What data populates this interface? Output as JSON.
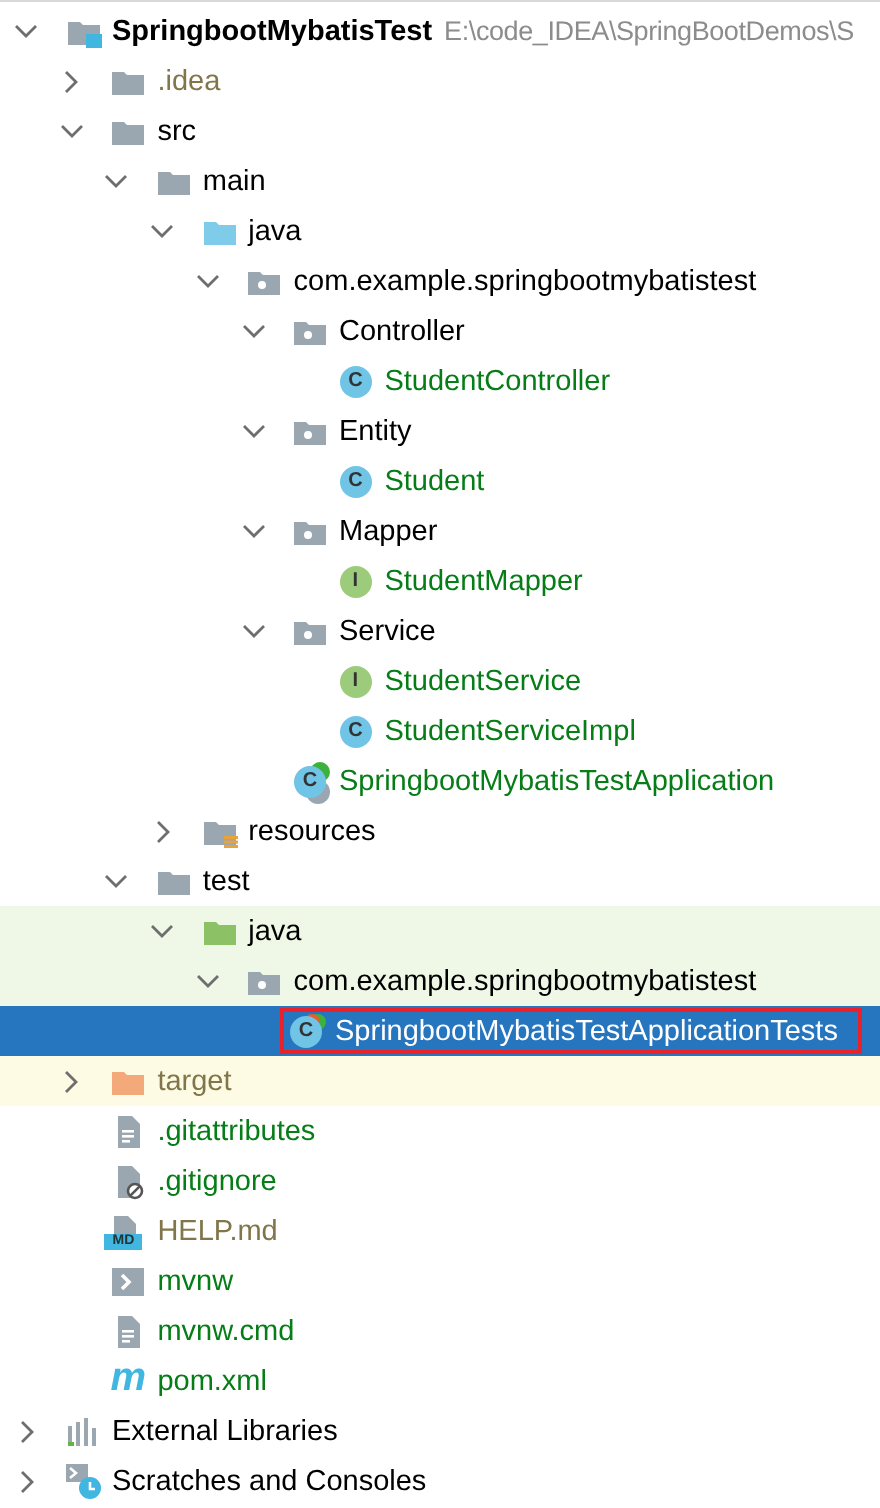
{
  "tree": [
    {
      "name": "SpringbootMybatisTest",
      "path": "E:\\code_IDEA\\SpringBootDemos\\S",
      "kind": "project",
      "color": "#000000",
      "expanded": true,
      "selected": false,
      "outlined": false,
      "children": [
        {
          "name": ".idea",
          "kind": "folder",
          "color": "#80764a",
          "expanded": false,
          "selected": false,
          "outlined": false
        },
        {
          "name": "src",
          "kind": "folder",
          "color": "#000000",
          "expanded": true,
          "selected": false,
          "outlined": false,
          "children": [
            {
              "name": "main",
              "kind": "folder",
              "color": "#000000",
              "expanded": true,
              "selected": false,
              "outlined": false,
              "children": [
                {
                  "name": "java",
                  "kind": "source-folder",
                  "color": "#000000",
                  "expanded": true,
                  "selected": false,
                  "outlined": false,
                  "children": [
                    {
                      "name": "com.example.springbootmybatistest",
                      "kind": "package",
                      "color": "#000000",
                      "expanded": true,
                      "selected": false,
                      "outlined": false,
                      "children": [
                        {
                          "name": "Controller",
                          "kind": "package",
                          "color": "#000000",
                          "expanded": true,
                          "selected": false,
                          "outlined": false,
                          "children": [
                            {
                              "name": "StudentController",
                              "kind": "class",
                              "icon_text": "C",
                              "color": "#067d17",
                              "selected": false,
                              "outlined": false
                            }
                          ]
                        },
                        {
                          "name": "Entity",
                          "kind": "package",
                          "color": "#000000",
                          "expanded": true,
                          "selected": false,
                          "outlined": false,
                          "children": [
                            {
                              "name": "Student",
                              "kind": "class",
                              "icon_text": "C",
                              "color": "#067d17",
                              "selected": false,
                              "outlined": false
                            }
                          ]
                        },
                        {
                          "name": "Mapper",
                          "kind": "package",
                          "color": "#000000",
                          "expanded": true,
                          "selected": false,
                          "outlined": false,
                          "children": [
                            {
                              "name": "StudentMapper",
                              "kind": "interface",
                              "icon_text": "I",
                              "color": "#067d17",
                              "selected": false,
                              "outlined": false
                            }
                          ]
                        },
                        {
                          "name": "Service",
                          "kind": "package",
                          "color": "#000000",
                          "expanded": true,
                          "selected": false,
                          "outlined": false,
                          "children": [
                            {
                              "name": "StudentService",
                              "kind": "interface",
                              "icon_text": "I",
                              "color": "#067d17",
                              "selected": false,
                              "outlined": false
                            },
                            {
                              "name": "StudentServiceImpl",
                              "kind": "class",
                              "icon_text": "C",
                              "color": "#067d17",
                              "selected": false,
                              "outlined": false
                            }
                          ]
                        },
                        {
                          "name": "SpringbootMybatisTestApplication",
                          "kind": "spring-app",
                          "icon_text": "C",
                          "color": "#067d17",
                          "selected": false,
                          "outlined": false
                        }
                      ]
                    }
                  ]
                },
                {
                  "name": "resources",
                  "kind": "resources-folder",
                  "color": "#000000",
                  "expanded": false,
                  "selected": false,
                  "outlined": false
                }
              ]
            },
            {
              "name": "test",
              "kind": "folder",
              "color": "#000000",
              "expanded": true,
              "selected": false,
              "outlined": false,
              "children": [
                {
                  "name": "java",
                  "kind": "test-folder",
                  "test_source": true,
                  "color": "#000000",
                  "expanded": true,
                  "selected": false,
                  "outlined": false,
                  "children": [
                    {
                      "name": "com.example.springbootmybatistest",
                      "kind": "package",
                      "test_source": true,
                      "color": "#000000",
                      "expanded": true,
                      "selected": false,
                      "outlined": false,
                      "children": [
                        {
                          "name": "SpringbootMybatisTestApplicationTests",
                          "kind": "test-class",
                          "icon_text": "C",
                          "selected": true,
                          "outlined": true
                        }
                      ]
                    }
                  ]
                }
              ]
            }
          ]
        },
        {
          "name": "target",
          "kind": "excluded-folder",
          "excluded": true,
          "color": "#80764a",
          "expanded": false,
          "selected": false,
          "outlined": false
        },
        {
          "name": ".gitattributes",
          "kind": "text-file",
          "color": "#067d17",
          "selected": false,
          "outlined": false
        },
        {
          "name": ".gitignore",
          "kind": "ignore-file",
          "color": "#067d17",
          "selected": false,
          "outlined": false
        },
        {
          "name": "HELP.md",
          "kind": "markdown-file",
          "icon_text": "MD",
          "color": "#80764a",
          "selected": false,
          "outlined": false
        },
        {
          "name": "mvnw",
          "kind": "script-file",
          "color": "#067d17",
          "selected": false,
          "outlined": false
        },
        {
          "name": "mvnw.cmd",
          "kind": "text-file",
          "color": "#067d17",
          "selected": false,
          "outlined": false
        },
        {
          "name": "pom.xml",
          "kind": "maven-file",
          "icon_text": "m",
          "color": "#067d17",
          "selected": false,
          "outlined": false
        }
      ]
    },
    {
      "name": "External Libraries",
      "kind": "libraries",
      "color": "#000000",
      "expanded": false,
      "selected": false,
      "outlined": false
    },
    {
      "name": "Scratches and Consoles",
      "kind": "scratches",
      "color": "#000000",
      "expanded": false,
      "selected": false,
      "outlined": false
    }
  ]
}
